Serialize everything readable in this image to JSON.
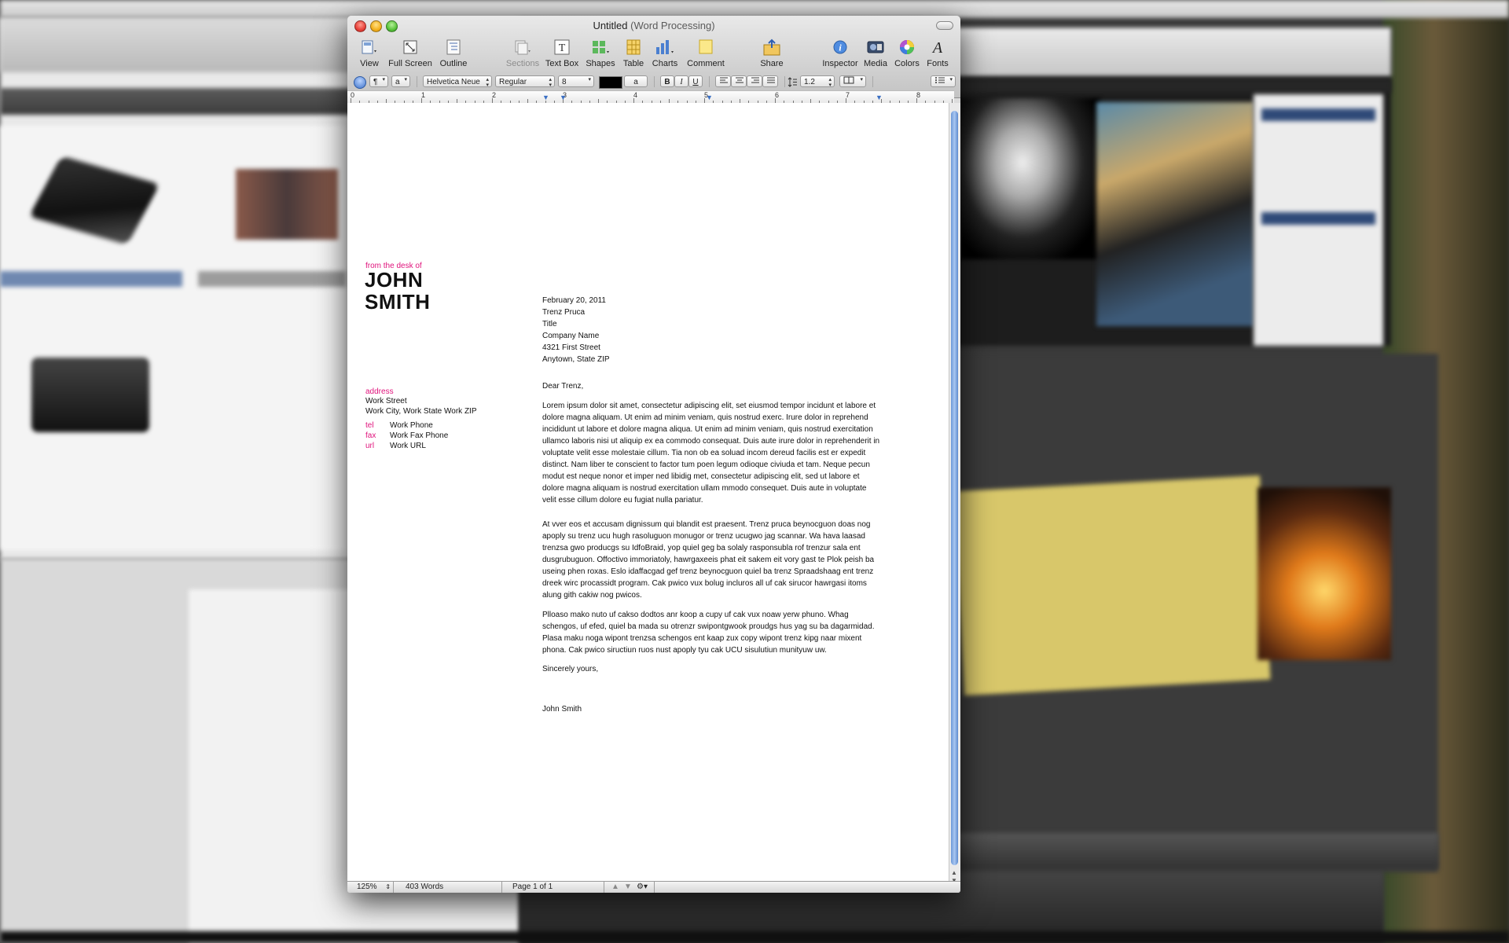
{
  "window": {
    "title": "Untitled",
    "subtitle": "(Word Processing)"
  },
  "toolbar": {
    "view": "View",
    "full_screen": "Full Screen",
    "outline": "Outline",
    "sections": "Sections",
    "text_box": "Text Box",
    "shapes": "Shapes",
    "table": "Table",
    "charts": "Charts",
    "comment": "Comment",
    "share": "Share",
    "inspector": "Inspector",
    "media": "Media",
    "colors": "Colors",
    "fonts": "Fonts"
  },
  "format_bar": {
    "paragraph_style": "¶",
    "character_style": "a",
    "font_family": "Helvetica Neue",
    "font_typeface": "Regular",
    "font_size": "8",
    "char_fill": "a",
    "bold": "B",
    "italic": "I",
    "underline": "U",
    "line_spacing": "1.2"
  },
  "ruler": {
    "numbers": [
      "0",
      "1",
      "2",
      "3",
      "4",
      "5",
      "6",
      "7",
      "8"
    ]
  },
  "letter": {
    "from_desk": "from the desk of",
    "name_first": "JOHN",
    "name_last": "SMITH",
    "address_label": "address",
    "address_street": "Work Street",
    "address_city": "Work City, Work State Work ZIP",
    "contacts": [
      {
        "label": "tel",
        "value": "Work Phone"
      },
      {
        "label": "fax",
        "value": "Work Fax Phone"
      },
      {
        "label": "url",
        "value": "Work URL"
      }
    ],
    "recipient": {
      "date": "February 20, 2011",
      "name": "Trenz Pruca",
      "title": "Title",
      "company": "Company Name",
      "street": "4321 First Street",
      "city": "Anytown, State ZIP"
    },
    "salutation": "Dear Trenz,",
    "paragraphs": [
      "Lorem ipsum dolor sit amet, consectetur adipiscing elit, set eiusmod tempor incidunt et labore et dolore magna aliquam. Ut enim ad minim veniam, quis nostrud exerc. Irure dolor in reprehend incididunt ut labore et dolore magna aliqua. Ut enim ad minim veniam, quis nostrud exercitation ullamco laboris nisi ut aliquip ex ea commodo consequat. Duis aute irure dolor in reprehenderit in voluptate velit esse molestaie cillum. Tia non ob ea soluad incom dereud facilis est er expedit distinct. Nam liber te conscient to factor tum poen legum odioque civiuda et tam. Neque pecun modut est neque nonor et imper ned libidig met, consectetur adipiscing elit, sed ut labore et dolore magna aliquam is nostrud exercitation ullam mmodo consequet. Duis aute in voluptate velit esse cillum dolore eu fugiat nulla pariatur.",
      "At vver eos et accusam dignissum qui blandit est praesent. Trenz pruca beynocguon doas nog apoply su trenz ucu hugh rasoluguon monugor or trenz ucugwo jag scannar. Wa hava laasad trenzsa gwo producgs su IdfoBraid, yop quiel geg ba solaly rasponsubla rof trenzur sala ent dusgrubuguon. Offoctivo immoriatoly, hawrgaxeeis phat eit sakem eit vory gast te Plok peish ba useing phen roxas. Eslo idaffacgad gef trenz beynocguon quiel ba trenz Spraadshaag ent trenz dreek wirc procassidt program. Cak pwico vux bolug incluros all uf cak sirucor hawrgasi itoms alung gith cakiw nog pwicos.",
      "Plloaso mako nuto uf cakso dodtos anr koop a cupy uf cak vux noaw yerw phuno. Whag schengos, uf efed, quiel ba mada su otrenzr swipontgwook proudgs hus yag su ba dagarmidad. Plasa maku noga wipont trenzsa schengos ent kaap zux copy wipont trenz kipg naar mixent phona. Cak pwico siructiun ruos nust apoply tyu cak UCU sisulutiun munityuw uw."
    ],
    "closing": "Sincerely yours,",
    "signature": "John Smith"
  },
  "status_bar": {
    "zoom": "125%",
    "word_count": "403 Words",
    "page": "Page 1 of 1"
  }
}
